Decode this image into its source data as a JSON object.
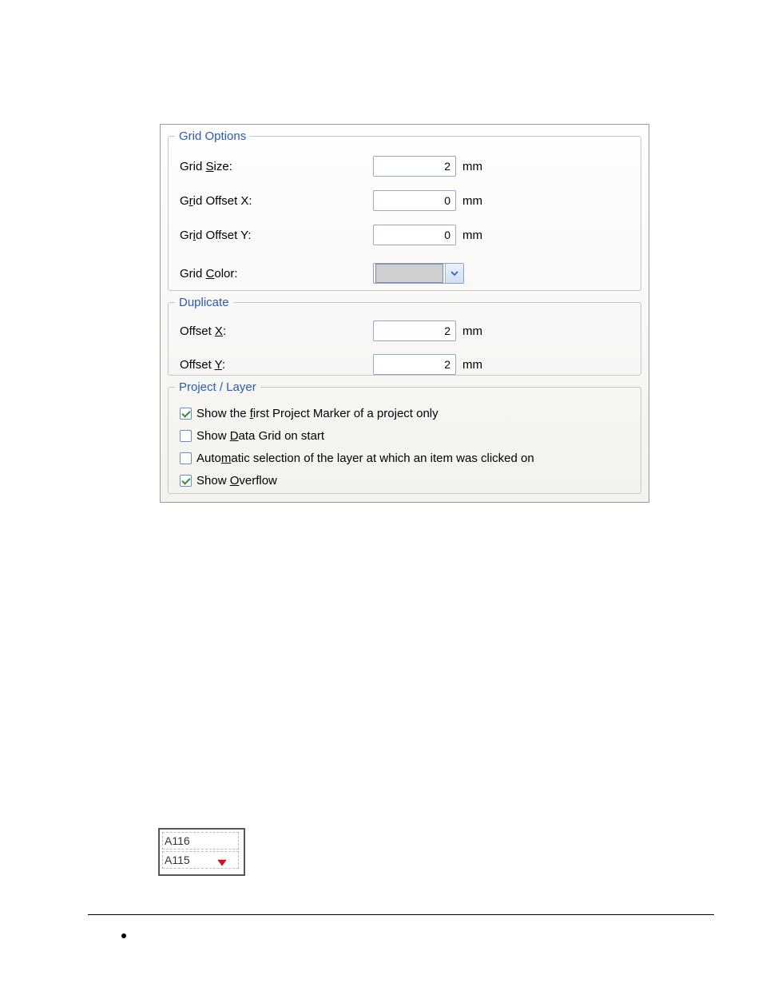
{
  "gridOptions": {
    "legend": "Grid Options",
    "gridSize": {
      "label": "Grid Size:",
      "accel": "S",
      "value": "2",
      "unit": "mm"
    },
    "gridOffsetX": {
      "label": "Grid Offset X:",
      "accel": "r",
      "value": "0",
      "unit": "mm"
    },
    "gridOffsetY": {
      "label": "Grid Offset Y:",
      "accel": "i",
      "value": "0",
      "unit": "mm"
    },
    "gridColor": {
      "label": "Grid Color:",
      "accel": "C",
      "swatch": "#cfcfcf"
    }
  },
  "duplicate": {
    "legend": "Duplicate",
    "offsetX": {
      "label": "Offset X:",
      "accel": "X",
      "value": "2",
      "unit": "mm"
    },
    "offsetY": {
      "label": "Offset Y:",
      "accel": "Y",
      "value": "2",
      "unit": "mm"
    }
  },
  "projectLayer": {
    "legend": "Project / Layer",
    "showFirstMarker": {
      "label": "Show the first Project Marker of a project only",
      "accel": "f",
      "checked": true
    },
    "showDataGrid": {
      "label": "Show Data Grid on start",
      "accel": "D",
      "checked": false
    },
    "autoLayer": {
      "label": "Automatic selection of the layer at which an item was clicked on",
      "accel": "m",
      "checked": false
    },
    "showOverflow": {
      "label": "Show Overflow",
      "accel": "O",
      "checked": true
    }
  },
  "overflowSample": {
    "cellTop": "A116",
    "cellBottom": "A115"
  }
}
